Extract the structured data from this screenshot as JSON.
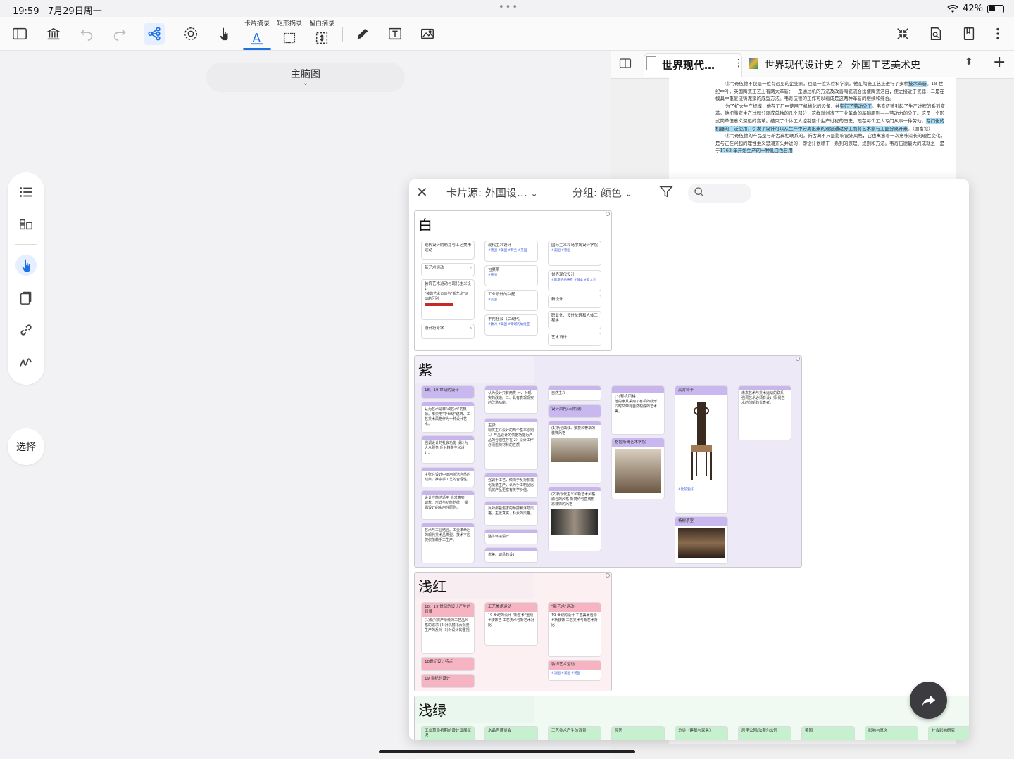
{
  "status": {
    "time": "19:59",
    "date": "7月29日周一",
    "battery": "42%"
  },
  "toolbar": {
    "label_card": "卡片摘录",
    "label_rect": "矩形摘录",
    "label_blank": "留白摘录"
  },
  "mindmap": {
    "title": "主脑图"
  },
  "sidebar": {
    "select_label": "选择"
  },
  "doc": {
    "tab1": "世界现代…",
    "tab2": "世界现代设计史 2",
    "tab3": "外国工艺美术史",
    "para1_a": "②韦奇伍德不仅是一位有远见的企业家，也是一位实验科学家。他在陶瓷工艺上进行了多种",
    "para1_hl": "技术革新",
    "para1_b": "。18 世纪中叶，英国陶瓷工艺上有两大革新：一是通过机的方法及改善陶瓷流合比使陶瓷洁白，使之接近于瓷器；二是在模具中重复浇铸泥浆的成型方法。韦奇伍德的工作可以看成是这两种革新的继续和综合。",
    "para2_a": "为了扩大生产规模，他在工厂中使用了机械化的设备，并",
    "para2_hl1": "实行了劳动分工",
    "para2_b": "。韦奇伍德引起了生产过程的系列变革。他把陶瓷生产过程分离成单独的几个部分，这样就创造了工业革命的基础原则——劳动力的分工。这是一个形式简单但意义深远的变革。结束了个体工人控制整个生产过程的历史，现在每个工人专门从事一种劳动。",
    "para2_hl2": "专门化的机器的广泛使用，引发了设计可以从生产中分离出来的观念通过分工而将艺术家与工匠分离开来",
    "para2_c": "。（国富论）",
    "para3_a": "③韦奇伍德的产品是与新古典相联系的。新古典不只是影响设计风格，它也寓意着一次意味深长的理性变化，是与正在兴起的理性主义思潮齐头并进的，即设计依赖于一系列的原理、规则和方法。韦奇伍德最大的成就之一是于",
    "para3_hl": "1763 年开始生产的一种乳白色日用"
  },
  "panel": {
    "source": "卡片源: 外国设…",
    "group_by": "分组: 颜色",
    "groups": {
      "white": "白",
      "purple": "紫",
      "pink": "浅红",
      "green": "浅绿"
    },
    "white_cards": [
      {
        "title": "现代设计的萌芽与工艺美术运动",
        "tags": ""
      },
      {
        "title": "新艺术运动",
        "tags": ""
      },
      {
        "title": "装饰艺术运动与现代主义设计",
        "tags": "\"装饰艺术运动与\"新艺术\"运动的区别"
      },
      {
        "title": "设计符号学",
        "tags": ""
      },
      {
        "title": "现代主义设计",
        "tags": "#德国 #美国 #荷兰 #英国"
      },
      {
        "title": "包豪斯",
        "tags": "#德国"
      },
      {
        "title": "工业设计的兴起",
        "tags": "#美国"
      },
      {
        "title": "丰裕社会（后现代）",
        "tags": "#欧洲 #美国 #斯堪的纳维亚"
      },
      {
        "title": "国际主义和乌尔姆设计学院",
        "tags": "#美国 #德国"
      },
      {
        "title": "世界现代设计",
        "tags": "#斯堪的纳维亚 #日本 #意大利"
      },
      {
        "title": "新设计",
        "tags": ""
      },
      {
        "title": "职业化、设计伦理和人体工程学",
        "tags": ""
      },
      {
        "title": "艺术设计",
        "tags": ""
      }
    ],
    "purple_cards": [
      {
        "title": "18、19 世纪的设计",
        "text": ""
      },
      {
        "title": "",
        "text": "认为艺术是非\"改艺术\"的根源。推崇用\"中世纪\"建筑、工艺美术风格作为一种设计艺术。"
      },
      {
        "title": "",
        "text": "强调设计的社会功能 设计为大众服务 反对精英主义设计。"
      },
      {
        "title": "",
        "text": "主张在设计中运用简洁自然的线条，推崇手工艺的合理性。"
      },
      {
        "title": "",
        "text": "设计应简洁适用 追求真实、诚挚、形式与功能的统一 提倡设计的实用性原则。"
      },
      {
        "title": "",
        "text": "艺术与工业结合。工业革命后的现代美术品类型。技术不应仅仅依赖手工生产。"
      },
      {
        "title": "",
        "text": "认为设计只有两类 一、对现实的改造。二、具有表现现实的改造功能。"
      },
      {
        "title": "主张",
        "text": "现实主义设计的两个基本原则 1）产品设计的依据功能为产品的合理性存在 2）设计工作必须追随材料的性质"
      },
      {
        "title": "",
        "text": "强调手工艺，倾向于反对机械化批量生产，认为手工制品比机械产品更富有美学价值。"
      },
      {
        "title": "",
        "text": "反对那些追求的矫揉和浮夸风格，主张真实、朴素的风格。"
      },
      {
        "title": "",
        "text": "整体环境设计"
      },
      {
        "title": "",
        "text": "优美、诚恳的设计"
      },
      {
        "title": "",
        "text": "自然主义"
      },
      {
        "title": "设计风格(三阶段)",
        "text": ""
      },
      {
        "title": "",
        "text": "(1)新记曲线、繁复和奢华的装饰风格"
      },
      {
        "title": "",
        "text": "(2)新现代主义和新艺术风格融合的风格 新简约与直线形态装饰的风格"
      },
      {
        "title": "(3)有机风格",
        "text": "他的家具采用了有机的线形 同时又带有自然构成的艺术美。"
      },
      {
        "title": "格拉斯哥艺术学院",
        "text": ""
      },
      {
        "title": "高背椅子",
        "text": "#比较爱好"
      },
      {
        "title": "杨柳茶室",
        "text": ""
      },
      {
        "title": "",
        "text": "未来艺术与美术运动的联系 强调艺术必须有设计师 是艺术的创新的代表者。"
      }
    ],
    "pink_cards": [
      {
        "title": "18、19 世纪的设计产生的背景",
        "text": "(1)新兴资产阶级对工艺品风格的追求 (2)对机械化大批量生产的反对 (3)对设计的重视"
      },
      {
        "title": "18世纪设计特点",
        "text": ""
      },
      {
        "title": "19 世纪的设计",
        "text": ""
      },
      {
        "title": "工艺美术运动",
        "text": "19 世纪的设计 \"新艺术\"运动 #装饰艺 工艺美术与新艺术对比"
      },
      {
        "title": "\"新艺术\"运动",
        "text": "19 世纪的设计 工艺美术运动 #新装饰 工艺美术与新艺术对比"
      },
      {
        "title": "装饰艺术运动",
        "text": "#法国 #美国 #英国"
      }
    ],
    "green_cards": [
      {
        "title": "工业革命初期的设计发展状况"
      },
      {
        "title": "水晶宫博览会"
      },
      {
        "title": "工艺美术产生的背景"
      },
      {
        "title": "原因"
      },
      {
        "title": "分类（建筑与家具）"
      },
      {
        "title": "居里公园/法斯尔公园"
      },
      {
        "title": "英国"
      },
      {
        "title": "影响与意义"
      },
      {
        "title": "社会影响研究"
      }
    ]
  },
  "colors": {
    "accent": "#1f6fe5",
    "purple_group": "#ede9f6",
    "purple_card_head": "#c9b7ef",
    "pink_group": "#fdf0f3",
    "pink_card_head": "#f6b4c3",
    "green_group": "#f0faf2",
    "green_card_head": "#c7f0cf",
    "highlight": "#a9dcf6"
  }
}
